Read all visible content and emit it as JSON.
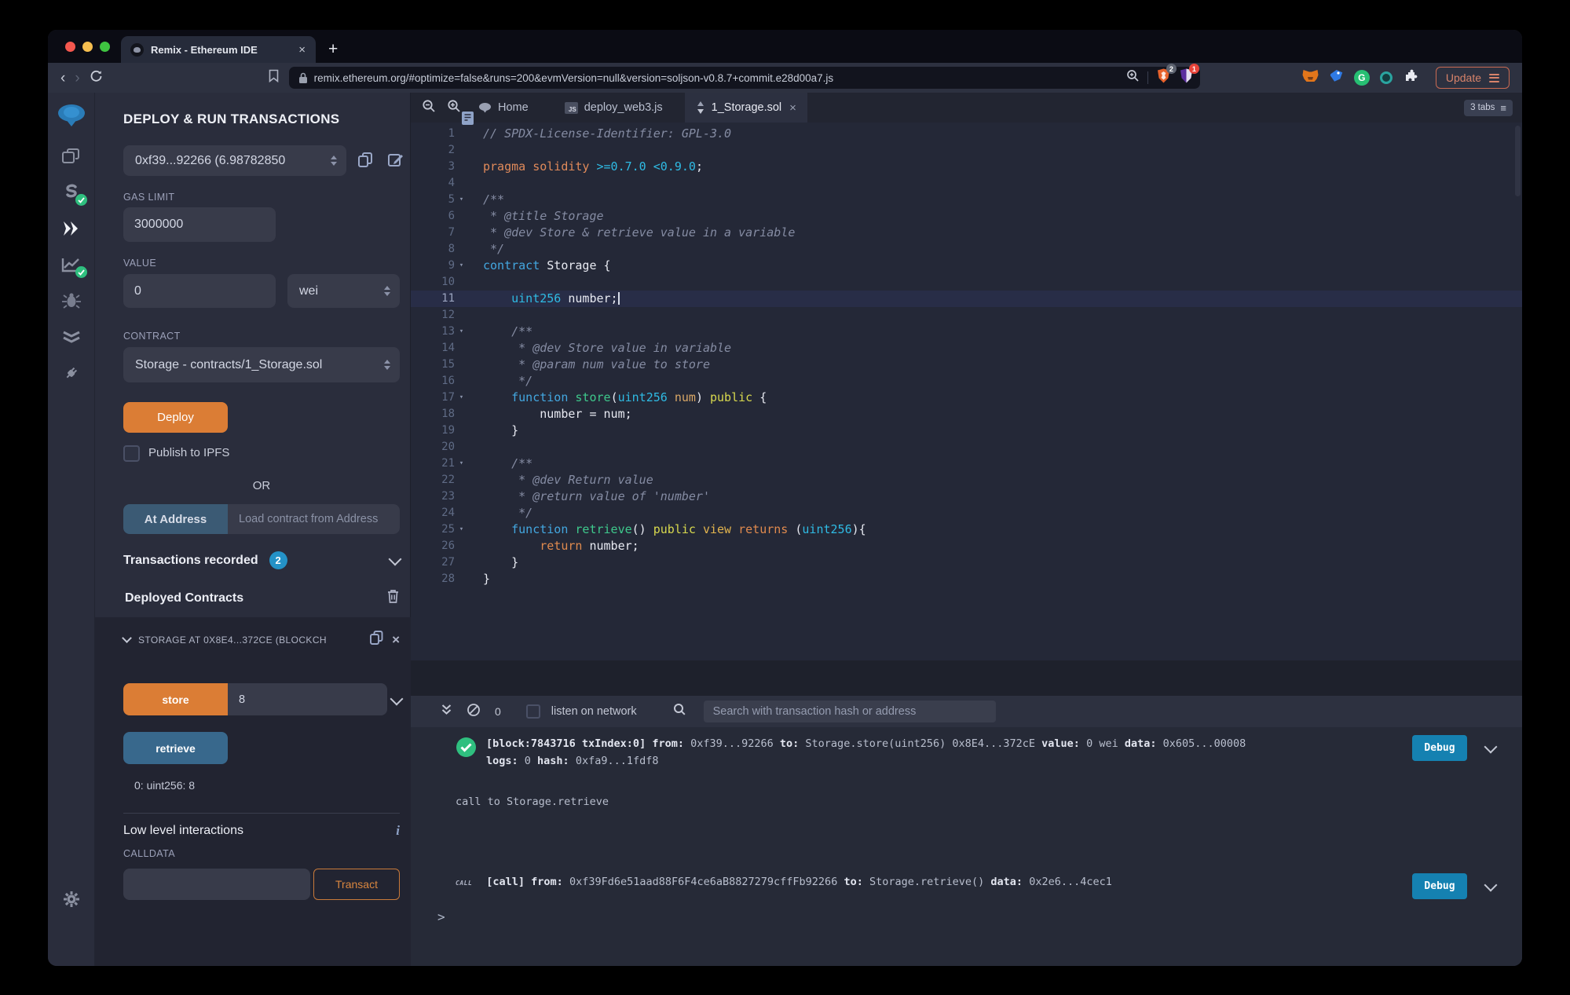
{
  "browser": {
    "tab_title": "Remix - Ethereum IDE",
    "new_tab": "+",
    "url": "remix.ethereum.org/#optimize=false&runs=200&evmVersion=null&version=soljson-v0.8.7+commit.e28d00a7.js",
    "shield_badge": "2",
    "triangle_badge": "1",
    "grammarly_letter": "G",
    "update_label": "Update"
  },
  "colors": {
    "accent_orange": "#db7d35",
    "debug_blue": "#1581b1",
    "retrieve_blue": "#38688c",
    "badge_blue": "#2492c7",
    "success_green": "#2fbf7f"
  },
  "rail_items": [
    "home-logo",
    "file-explorer",
    "solidity-compiler",
    "deploy-and-run",
    "static-analysis",
    "debugger",
    "unit-testing",
    "plugin-manager",
    "settings"
  ],
  "panel": {
    "title": "DEPLOY & RUN TRANSACTIONS",
    "account_value": "0xf39...92266 (6.98782850",
    "gas_label": "GAS LIMIT",
    "gas_value": "3000000",
    "value_label": "VALUE",
    "value_value": "0",
    "unit_value": "wei",
    "contract_label": "CONTRACT",
    "contract_value": "Storage - contracts/1_Storage.sol",
    "deploy_label": "Deploy",
    "ipfs_label": "Publish to IPFS",
    "or_label": "OR",
    "at_address_label": "At Address",
    "at_address_placeholder": "Load contract from Address",
    "tx_recorded_label": "Transactions recorded",
    "tx_recorded_count": "2",
    "deployed_label": "Deployed Contracts",
    "instance_title": "STORAGE AT 0X8E4...372CE (BLOCKCH",
    "store_label": "store",
    "store_value": "8",
    "retrieve_label": "retrieve",
    "retrieve_result": "0: uint256: 8",
    "low_level_label": "Low level interactions",
    "info_glyph": "i",
    "calldata_label": "CALLDATA",
    "transact_label": "Transact"
  },
  "editor": {
    "tabs": [
      {
        "label": "Home"
      },
      {
        "label": "deploy_web3.js"
      },
      {
        "label": "1_Storage.sol"
      }
    ],
    "tabs_badge": "3 tabs",
    "lines": [
      {
        "n": 1,
        "segs": [
          {
            "t": "// SPDX-License-Identifier: GPL-3.0",
            "c": "com"
          }
        ]
      },
      {
        "n": 2,
        "segs": []
      },
      {
        "n": 3,
        "segs": [
          {
            "t": "pragma solidity ",
            "c": "kw2"
          },
          {
            "t": ">=0.7.0 <0.9.0",
            "c": "num"
          },
          {
            "t": ";"
          }
        ]
      },
      {
        "n": 4,
        "segs": []
      },
      {
        "n": 5,
        "fold": true,
        "segs": [
          {
            "t": "/**",
            "c": "com"
          }
        ]
      },
      {
        "n": 6,
        "segs": [
          {
            "t": " * @title Storage",
            "c": "com"
          }
        ]
      },
      {
        "n": 7,
        "segs": [
          {
            "t": " * @dev Store & retrieve value in a variable",
            "c": "com"
          }
        ]
      },
      {
        "n": 8,
        "segs": [
          {
            "t": " */",
            "c": "com"
          }
        ]
      },
      {
        "n": 9,
        "fold": true,
        "segs": [
          {
            "t": "contract ",
            "c": "kw"
          },
          {
            "t": "Storage {"
          }
        ]
      },
      {
        "n": 10,
        "segs": []
      },
      {
        "n": 11,
        "cur": true,
        "cursor": true,
        "segs": [
          {
            "t": "    "
          },
          {
            "t": "uint256 ",
            "c": "typ"
          },
          {
            "t": "number;"
          }
        ]
      },
      {
        "n": 12,
        "segs": []
      },
      {
        "n": 13,
        "fold": true,
        "segs": [
          {
            "t": "    /**",
            "c": "com"
          }
        ]
      },
      {
        "n": 14,
        "segs": [
          {
            "t": "     * @dev Store value in variable",
            "c": "com"
          }
        ]
      },
      {
        "n": 15,
        "segs": [
          {
            "t": "     * @param num value to store",
            "c": "com"
          }
        ]
      },
      {
        "n": 16,
        "segs": [
          {
            "t": "     */",
            "c": "com"
          }
        ]
      },
      {
        "n": 17,
        "fold": true,
        "segs": [
          {
            "t": "    "
          },
          {
            "t": "function ",
            "c": "kw"
          },
          {
            "t": "store",
            "c": "fn"
          },
          {
            "t": "("
          },
          {
            "t": "uint256 ",
            "c": "typ"
          },
          {
            "t": "num",
            "c": "par"
          },
          {
            "t": ") "
          },
          {
            "t": "public ",
            "c": "mod"
          },
          {
            "t": "{"
          }
        ]
      },
      {
        "n": 18,
        "segs": [
          {
            "t": "        number = num;"
          }
        ]
      },
      {
        "n": 19,
        "segs": [
          {
            "t": "    }"
          }
        ]
      },
      {
        "n": 20,
        "segs": []
      },
      {
        "n": 21,
        "fold": true,
        "segs": [
          {
            "t": "    /**",
            "c": "com"
          }
        ]
      },
      {
        "n": 22,
        "segs": [
          {
            "t": "     * @dev Return value",
            "c": "com"
          }
        ]
      },
      {
        "n": 23,
        "segs": [
          {
            "t": "     * @return value of 'number'",
            "c": "com"
          }
        ]
      },
      {
        "n": 24,
        "segs": [
          {
            "t": "     */",
            "c": "com"
          }
        ]
      },
      {
        "n": 25,
        "fold": true,
        "segs": [
          {
            "t": "    "
          },
          {
            "t": "function ",
            "c": "kw"
          },
          {
            "t": "retrieve",
            "c": "fn"
          },
          {
            "t": "() "
          },
          {
            "t": "public ",
            "c": "mod"
          },
          {
            "t": "view ",
            "c": "mod2"
          },
          {
            "t": "returns ",
            "c": "ret"
          },
          {
            "t": "("
          },
          {
            "t": "uint256",
            "c": "typ"
          },
          {
            "t": "){"
          }
        ]
      },
      {
        "n": 26,
        "segs": [
          {
            "t": "        "
          },
          {
            "t": "return ",
            "c": "ret"
          },
          {
            "t": "number;"
          }
        ]
      },
      {
        "n": 27,
        "segs": [
          {
            "t": "    }"
          }
        ]
      },
      {
        "n": 28,
        "segs": [
          {
            "t": "}"
          }
        ]
      }
    ]
  },
  "terminal": {
    "count": "0",
    "listen_label": "listen on network",
    "search_placeholder": "Search with transaction hash or address",
    "tx_line1": [
      {
        "t": "[block:7843716 txIndex:0] ",
        "b": 1
      },
      {
        "t": "from: ",
        "b": 1
      },
      {
        "t": "0xf39...92266 "
      },
      {
        "t": "to: ",
        "b": 1
      },
      {
        "t": "Storage.store(uint256) 0x8E4...372cE "
      },
      {
        "t": "value: ",
        "b": 1
      },
      {
        "t": "0 wei "
      },
      {
        "t": "data: ",
        "b": 1
      },
      {
        "t": "0x605...00008 "
      }
    ],
    "tx_line2": [
      {
        "t": "logs: ",
        "b": 1
      },
      {
        "t": "0 "
      },
      {
        "t": "hash: ",
        "b": 1
      },
      {
        "t": "0xfa9...1fdf8"
      }
    ],
    "info_line": "call to Storage.retrieve",
    "call_tag": "CALL",
    "call_line": [
      {
        "t": "[call] ",
        "b": 1
      },
      {
        "t": "from: ",
        "b": 1
      },
      {
        "t": "0xf39Fd6e51aad88F6F4ce6aB8827279cffFb92266 "
      },
      {
        "t": "to: ",
        "b": 1
      },
      {
        "t": "Storage.retrieve() "
      },
      {
        "t": "data: ",
        "b": 1
      },
      {
        "t": "0x2e6...4cec1"
      }
    ],
    "debug_label": "Debug",
    "prompt": ">"
  }
}
